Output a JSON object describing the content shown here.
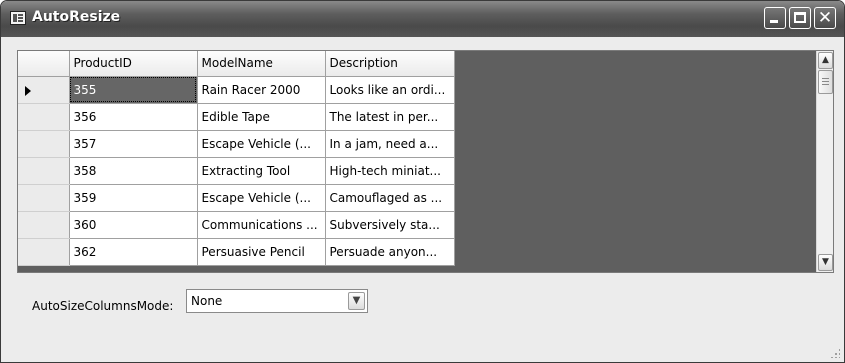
{
  "window": {
    "title": "AutoResize"
  },
  "grid": {
    "columns": [
      "ProductID",
      "ModelName",
      "Description"
    ],
    "rows": [
      {
        "id": "355",
        "model": "Rain Racer 2000",
        "desc": "Looks like an ordi..."
      },
      {
        "id": "356",
        "model": "Edible Tape",
        "desc": "The latest in per..."
      },
      {
        "id": "357",
        "model": "Escape Vehicle (...",
        "desc": "In a jam, need a..."
      },
      {
        "id": "358",
        "model": "Extracting Tool",
        "desc": "High-tech miniat..."
      },
      {
        "id": "359",
        "model": "Escape Vehicle (...",
        "desc": "Camouflaged as ..."
      },
      {
        "id": "360",
        "model": "Communications ...",
        "desc": "Subversively sta..."
      },
      {
        "id": "362",
        "model": "Persuasive Pencil",
        "desc": "Persuade anyon..."
      }
    ],
    "current_row": 0
  },
  "footer": {
    "mode_label": "AutoSizeColumnsMode:",
    "mode_value": "None"
  },
  "icons": {
    "app": "app-window-icon",
    "row_indicator": "row-indicator-arrow-icon",
    "scroll_up": "scroll-up-arrow-icon",
    "scroll_down": "scroll-down-arrow-icon",
    "dropdown": "chevron-down-icon"
  },
  "colors": {
    "titlebar": "#5e5e5e",
    "grid_background": "#5f5f5f",
    "selected_cell": "#666666",
    "window_background": "#ececec"
  }
}
